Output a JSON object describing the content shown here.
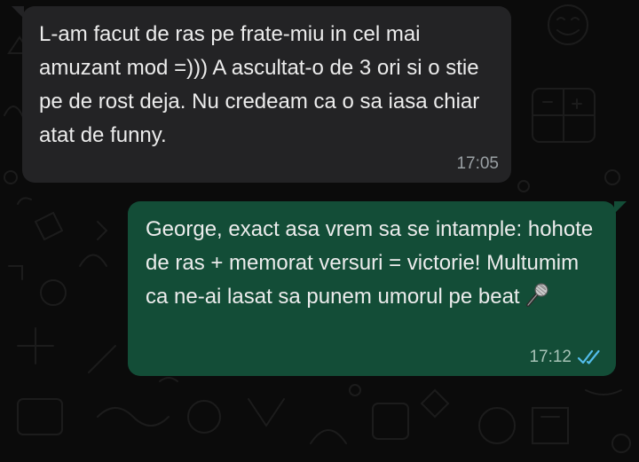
{
  "chat": {
    "messages": [
      {
        "direction": "incoming",
        "text": "L-am facut de ras pe frate-miu in cel mai amuzant mod =))) A ascultat-o de 3 ori si o stie pe de rost deja. Nu credeam ca o sa iasa chiar atat de funny.",
        "time": "17:05"
      },
      {
        "direction": "outgoing",
        "text": "George, exact asa vrem sa se intample: hohote de ras + memorat versuri = victorie! Multumim ca ne-ai lasat sa punem umorul pe beat",
        "emoji_icon": "microphone-icon",
        "time": "17:12",
        "status_icon": "double-check-read-icon"
      }
    ]
  },
  "colors": {
    "background": "#0b0b0b",
    "incoming_bubble": "#232325",
    "outgoing_bubble": "#134d37",
    "read_check": "#53bdeb"
  }
}
